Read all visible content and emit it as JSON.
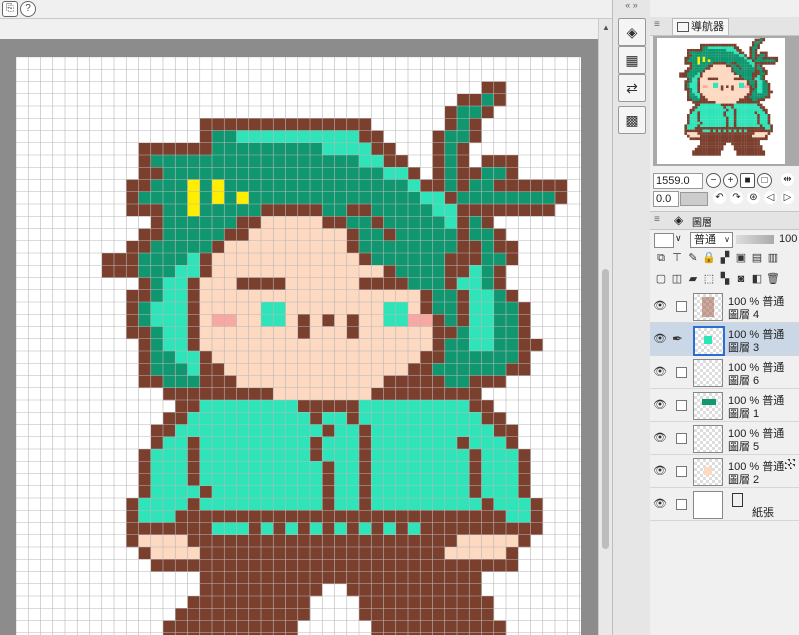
{
  "toolbar": {
    "help_icon": "?"
  },
  "navigator": {
    "title": "導航器",
    "zoom_value": "1559.0",
    "angle_value": "0.0"
  },
  "layers": {
    "title": "圖層",
    "blend_mode": "普通",
    "opacity": "100",
    "items": [
      {
        "line1": "100 % 普通",
        "line2": "圖層 4",
        "selected": false
      },
      {
        "line1": "100 % 普通",
        "line2": "圖層 3",
        "selected": true
      },
      {
        "line1": "100 % 普通",
        "line2": "圖層 6",
        "selected": false
      },
      {
        "line1": "100 % 普通",
        "line2": "圖層 1",
        "selected": false
      },
      {
        "line1": "100 % 普通",
        "line2": "圖層 5",
        "selected": false
      },
      {
        "line1": "100 % 普通",
        "line2": "圖層 2",
        "selected": false
      },
      {
        "line1": "",
        "line2": "紙張",
        "selected": false
      }
    ]
  },
  "palette": {
    ".": "#ffffff",
    "B": "#7b3f2e",
    "G": "#11976f",
    "L": "#2fe4b8",
    "S": "#fdd9c1",
    "P": "#f8a8a2",
    "Y": "#ffee00"
  },
  "pixel_art": [
    "..............................................",
    "..............................................",
    "......................................BB......",
    "....................................BBGB......",
    "...................................BGGB.......",
    "...............BBBBBBBBBBBBBB......BGB........",
    "...............BGGLLLLLLLLLLBB....BGGB........",
    "..........BBBBBBGGGGGGGGGLLLLBB...BGB.........",
    "..........BGGGGGGGGGGGGGGGGGLLBB..BGB.BBB.....",
    "..........BBGGGGGGGGGGGGGGGGGGLLB.BGBBGGB.....",
    ".........BBGGGYGYGGGGGGGGGGGGGGGLBBGBGGBBBBBB.",
    ".........BGGGGYGYGYGGGGGGGGGGGGGGLLBGGGGGGGGB.",
    ".........BBBGGYGGGGGBBBBBGGBBGGGGGLLBBBBBBBB..",
    "...........BGGGGGGBBSSSSSBBGGBGGGGGLBGB.......",
    "..........BBGGGGGBBSSSSSSSSBGGBGGGGGBGGB......",
    ".........BBGGGGGBSSSSSSSSSSBGGGGGGGGBBGBB.....",
    ".......BBBGGGGLBSSSSSSSSSSSSBGGGGGGBBBGGB.....",
    ".......BBBGGGLLBSSSSSSSSSSSSSSBGGGGBBLGB......",
    "..........BGLLBSSSBBBBSSSSSSBBBBGGGBLLGB......",
    ".........BBGLLBSSSSSSSSSSSSSSSSSSBGGBLLGB.....",
    ".........BGLLLBSSSSSLLSSSSSSSSLLSBGGBLLGGB....",
    ".........BGLLLBSPPSSLLSBSBSBSSLLPPBGBLLGGB....",
    ".........BBGLLBSSSSSSSSBSSSBSSSSSSBBGLLGGB....",
    "..........BGLLBSSSSSSSSSSSSSSSSSSSBGGLLGGBB...",
    "..........BGGLLBSSSSSSSSSSSSSSSSSBBGGGGGGB....",
    "..........BGGGLBBSSSSSSSSSSSSSSSBBGGGGGGBB....",
    "..........BBGGGBBBSSSSSSSSSSSSBBBBBGGBBB......",
    "............BBBBBBBBBSSSSSSSSBBBBBBBBB........",
    ".............BBLLLLLLLLBBBBBLLLLLLLLLBB.......",
    "............BBLLLLLLLLLLBLLBLLLLLLLLLLBB......",
    "...........BBLLLLLLLLLLLLBLLBLLLLLLLLLLBB.....",
    "...........BLLBLLLLLLLLLBLLLBLLLLLLLBLLLB.....",
    "..........BLLLBLLLLLLLLLBLLLBLLLLLLLLBLLLB....",
    "..........BLLLBLLLLLLLLLLBLLBLLLLLLLLBLLLB....",
    "..........BLLLBLLLLLLLLLLBLLBLLLLLLLLBLLLB....",
    "..........BLLLLBLLLLLLLLLBLLBLLLLLLLLBLLLB....",
    ".........BLLLLBLLLLLLLLLLBLLBLLLLLLLLLBLLLB...",
    ".........BLLLBBBBBBBBBBBBBBBBBBBBBBBBBBBLLB...",
    ".........BBBBBBBLLLBLBLBLBLBLBLBLBBBBBBBBBB...",
    ".........BSSSSBBBBBBBBBBBBBBBBBBBBBBSSSSSB....",
    "..........BSSSSBBBBBBBBBBBBBBBBBBBBSSSSSB.....",
    "...........BBBBBBBBBBBBBBBBBBBBBBBBBBBBBB.....",
    "...............BBBBBBBBBBBBBBBBBBBBBBB........",
    "...............BBBBBBBBBB..BBBBBBBBBBB........",
    "..............BBBBBBBBBB....BBBBBBBBBBB.......",
    ".............BBBBBBBBBBB....BBBBBBBBBBB.......",
    "............BBBBBBBBBBB......BBBBBBBBBBB......",
    "............BBBBBBBBBBB......BBBBBBBBBBB......"
  ]
}
